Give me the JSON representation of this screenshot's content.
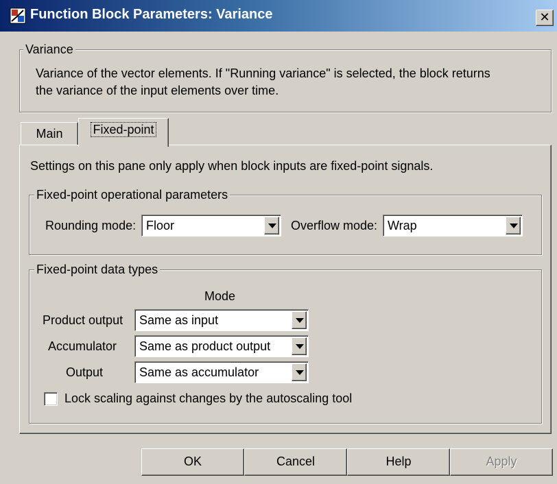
{
  "window": {
    "title": "Function Block Parameters: Variance",
    "close_glyph": "✕"
  },
  "description": {
    "group_label": "Variance",
    "line1": "Variance of the vector elements. If \"Running variance\" is selected, the block returns",
    "line2": "the variance of the input elements over time."
  },
  "tabs": [
    {
      "label": "Main",
      "selected": false
    },
    {
      "label": "Fixed-point",
      "selected": true
    }
  ],
  "fixed_point_pane": {
    "note": "Settings on this pane only apply when block inputs are fixed-point signals.",
    "operational": {
      "group_label": "Fixed-point operational parameters",
      "rounding_label": "Rounding mode:",
      "rounding_value": "Floor",
      "overflow_label": "Overflow mode:",
      "overflow_value": "Wrap"
    },
    "data_types": {
      "group_label": "Fixed-point data types",
      "mode_header": "Mode",
      "rows": [
        {
          "label": "Product output",
          "value": "Same as input"
        },
        {
          "label": "Accumulator",
          "value": "Same as product output"
        },
        {
          "label": "Output",
          "value": "Same as accumulator"
        }
      ],
      "lock_label": "Lock scaling against changes by the autoscaling tool",
      "lock_checked": false
    }
  },
  "buttons": {
    "ok": "OK",
    "cancel": "Cancel",
    "help": "Help",
    "apply": "Apply",
    "apply_enabled": false
  }
}
